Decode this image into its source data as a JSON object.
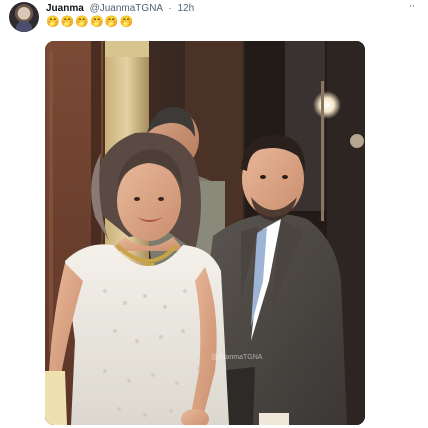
{
  "tweet": {
    "display_name": "Juanma",
    "handle": "@JuanmaTGNA",
    "separator": "·",
    "time": "12h",
    "more_label": "··",
    "text": "🤭🤭🤭🤭🤭🤭"
  },
  "media": {
    "watermark": "@JuanmaTGNA"
  }
}
